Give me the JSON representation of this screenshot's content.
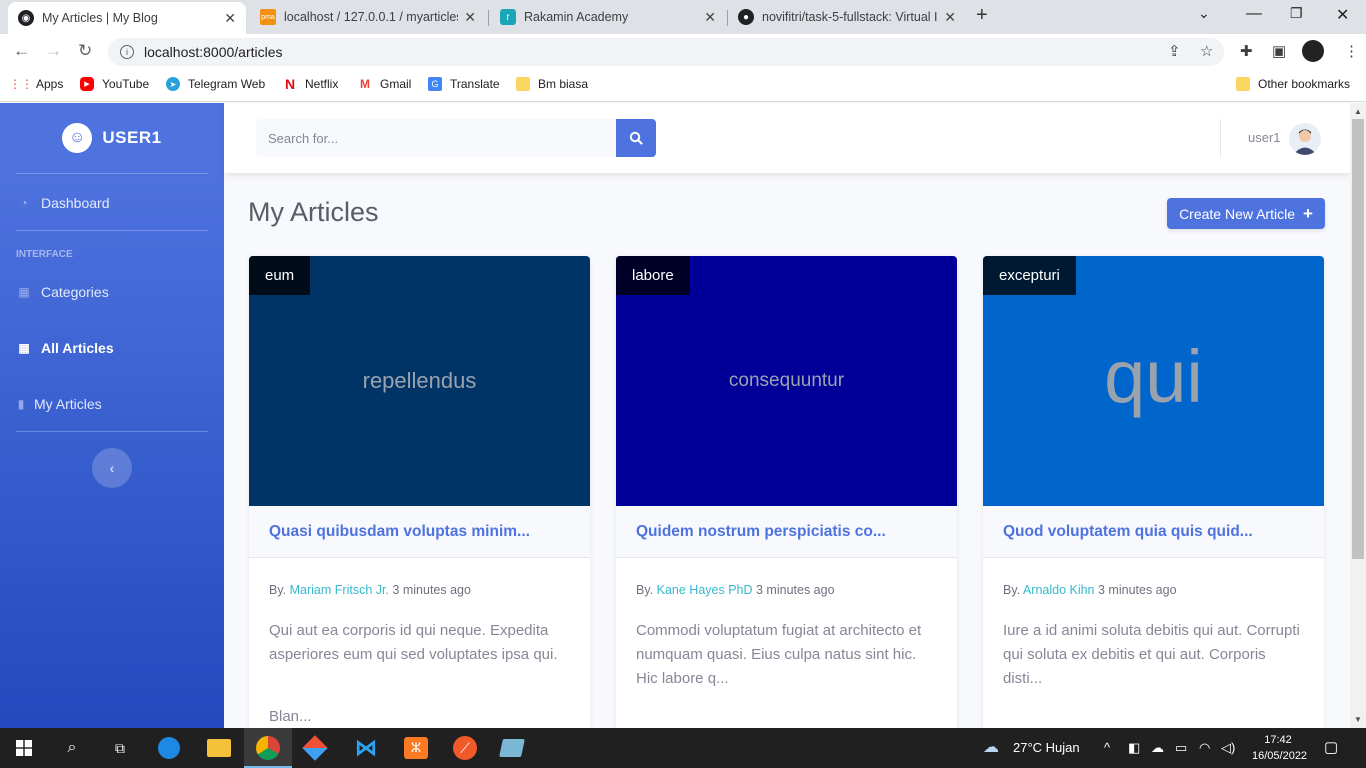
{
  "browser": {
    "tabs": [
      {
        "title": "My Articles | My Blog"
      },
      {
        "title": "localhost / 127.0.0.1 / myarticles"
      },
      {
        "title": "Rakamin Academy"
      },
      {
        "title": "novifitri/task-5-fullstack: Virtual I"
      }
    ],
    "url": "localhost:8000/articles",
    "bookmarks": [
      "Apps",
      "YouTube",
      "Telegram Web",
      "Netflix",
      "Gmail",
      "Translate",
      "Bm biasa"
    ],
    "other_bookmarks": "Other bookmarks"
  },
  "sidebar": {
    "brand": "USER1",
    "items": [
      {
        "label": "Dashboard"
      },
      {
        "label": "Categories"
      },
      {
        "label": "All Articles"
      },
      {
        "label": "My Articles"
      }
    ],
    "heading": "INTERFACE"
  },
  "topbar": {
    "search_placeholder": "Search for...",
    "username": "user1"
  },
  "page": {
    "title": "My Articles",
    "create_label": "Create New Article"
  },
  "articles": [
    {
      "category": "eum",
      "image_text": "repellendus",
      "image_bg": "#003366",
      "title": "Quasi quibusdam voluptas minim...",
      "by": "By.",
      "author": "Mariam Fritsch Jr.",
      "time": "3 minutes ago",
      "excerpt": "Qui aut ea corporis id qui neque. Expedita asperiores eum qui sed voluptates ipsa qui.",
      "more": "Blan..."
    },
    {
      "category": "labore",
      "image_text": "consequuntur",
      "image_bg": "#000099",
      "title": "Quidem nostrum perspiciatis co...",
      "by": "By.",
      "author": "Kane Hayes PhD",
      "time": "3 minutes ago",
      "excerpt": "Commodi voluptatum fugiat at architecto et numquam quasi. Eius culpa natus sint hic. Hic labore q...",
      "more": ""
    },
    {
      "category": "excepturi",
      "image_text": "qui",
      "image_bg": "#0066cc",
      "title": "Quod voluptatem quia quis quid...",
      "by": "By.",
      "author": "Arnaldo Kihn",
      "time": "3 minutes ago",
      "excerpt": "Iure a id animi soluta debitis qui aut. Corrupti qui soluta ex debitis et qui aut. Corporis disti...",
      "more": ""
    }
  ],
  "taskbar": {
    "weather": "27°C  Hujan",
    "time": "17:42",
    "date": "16/05/2022"
  },
  "colors": {
    "primary": "#4e73df",
    "info": "#36b9cc",
    "text_gray": "#858796"
  }
}
